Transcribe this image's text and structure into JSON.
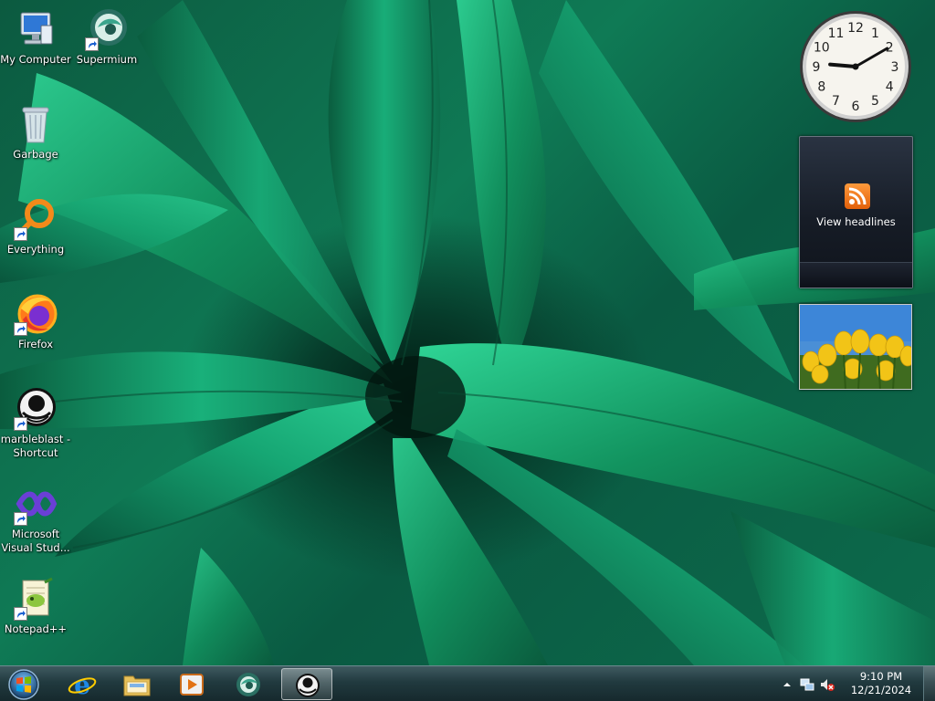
{
  "desktop": {
    "icons": [
      {
        "label": "My Computer",
        "icon": "computer-icon",
        "shortcut": false
      },
      {
        "label": "Supermium",
        "icon": "supermium-icon",
        "shortcut": true
      },
      {
        "label": "Garbage",
        "icon": "recycle-bin-icon",
        "shortcut": false
      },
      {
        "label": "Everything",
        "icon": "everything-icon",
        "shortcut": true
      },
      {
        "label": "Firefox",
        "icon": "firefox-icon",
        "shortcut": true
      },
      {
        "label": "marbleblast -\nShortcut",
        "icon": "marbleblast-icon",
        "shortcut": true
      },
      {
        "label": "Microsoft\nVisual Stud...",
        "icon": "visual-studio-icon",
        "shortcut": true
      },
      {
        "label": "Notepad++",
        "icon": "notepadplusplus-icon",
        "shortcut": true
      }
    ]
  },
  "gadgets": {
    "clock": {
      "hour_marks": [
        "12",
        "1",
        "2",
        "3",
        "4",
        "5",
        "6",
        "7",
        "8",
        "9",
        "10",
        "11"
      ],
      "hour": 9,
      "minute": 10
    },
    "feed": {
      "label": "View headlines",
      "icon": "rss-icon"
    },
    "slideshow": {
      "icon": "tulips-photo"
    }
  },
  "taskbar": {
    "start_icon": "windows-orb-icon",
    "pinned": [
      {
        "icon": "internet-explorer-icon",
        "active": false
      },
      {
        "icon": "file-explorer-icon",
        "active": false
      },
      {
        "icon": "media-player-icon",
        "active": false
      },
      {
        "icon": "supermium-icon",
        "active": false
      },
      {
        "icon": "marbleblast-icon",
        "active": true
      }
    ],
    "tray": {
      "show_hidden_icon": "chevron-up-icon",
      "network_icon": "network-icon",
      "volume_icon": "volume-muted-icon",
      "time": "9:10 PM",
      "date": "12/21/2024"
    }
  },
  "colors": {
    "wallpaper_base": "#0c5a40",
    "leaf_light": "#23c48a",
    "taskbar": "#213a3f",
    "rss_orange": "#f28a2a"
  }
}
